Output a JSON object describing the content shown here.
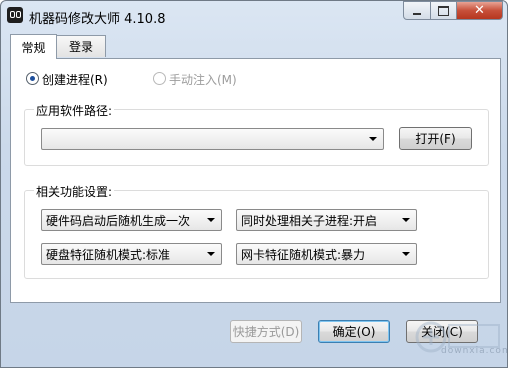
{
  "window": {
    "title": "机器码修改大师 4.10.8"
  },
  "tabs": [
    {
      "label": "常规"
    },
    {
      "label": "登录"
    }
  ],
  "mode": {
    "create_process": "创建进程(R)",
    "manual_inject": "手动注入(M)",
    "selected": "create_process"
  },
  "path_group": {
    "title": "应用软件路径:",
    "value": "",
    "open_button": "打开(F)"
  },
  "settings_group": {
    "title": "相关功能设置:",
    "combos": [
      "硬件码启动后随机生成一次",
      "同时处理相关子进程:开启",
      "硬盘特征随机模式:标准",
      "网卡特征随机模式:暴力"
    ]
  },
  "footer": {
    "shortcut": "快捷方式(D)",
    "ok": "确定(O)",
    "close": "关闭(C)"
  },
  "watermark": {
    "text": "downxia.com"
  }
}
